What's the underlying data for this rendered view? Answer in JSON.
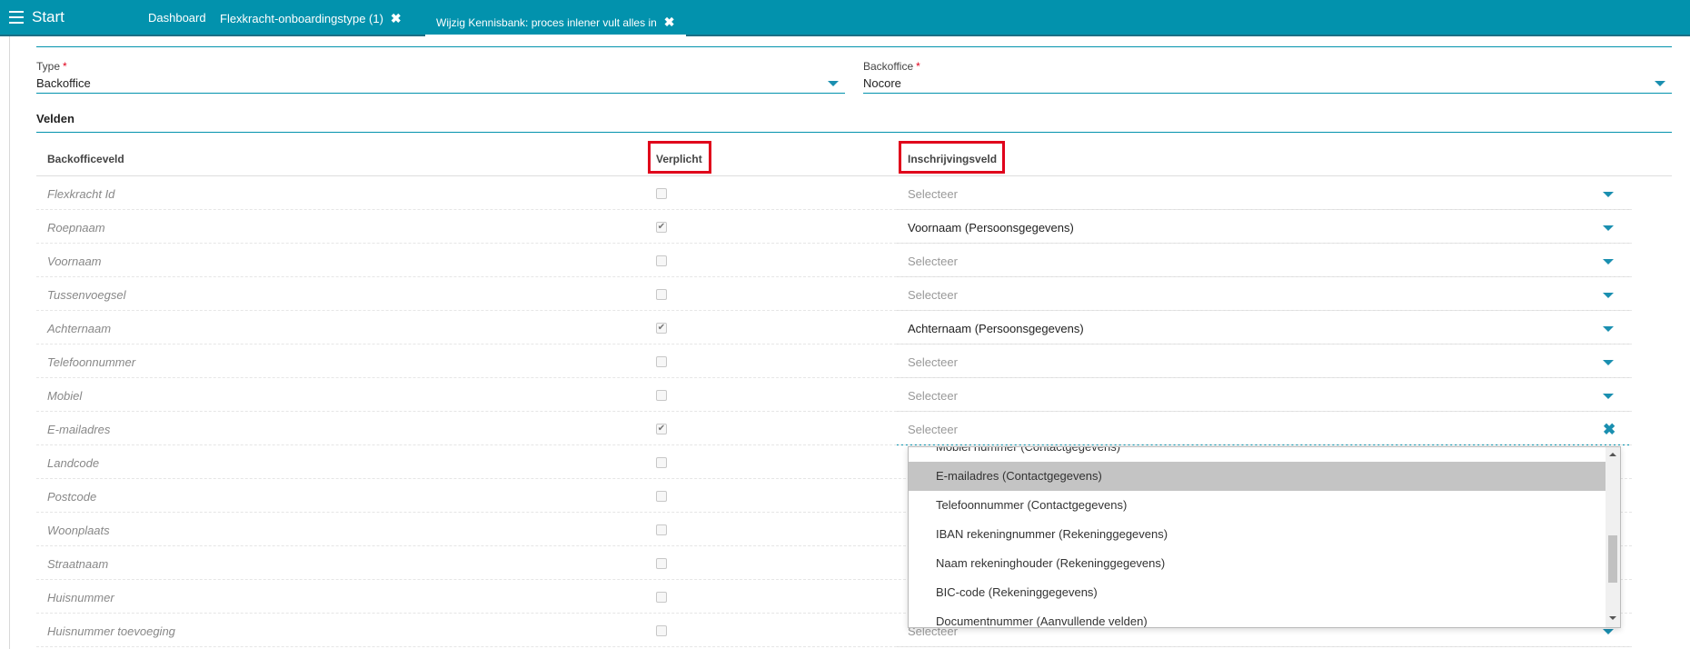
{
  "topbar": {
    "start_label": "Start",
    "tabs": [
      {
        "label": "Dashboard",
        "closable": false
      },
      {
        "label": "Flexkracht-onboardingstype (1)",
        "closable": true
      },
      {
        "label": "Wijzig Kennisbank: proces inlener vult alles in",
        "closable": true,
        "active": true
      }
    ],
    "close_glyph": "✖"
  },
  "form": {
    "type_label": "Type",
    "type_value": "Backoffice",
    "backoffice_label": "Backoffice",
    "backoffice_value": "Nocore",
    "required_mark": "*"
  },
  "velden": {
    "title": "Velden",
    "headers": {
      "backofficeveld": "Backofficeveld",
      "verplicht": "Verplicht",
      "inschrijvingsveld": "Inschrijvingsveld"
    },
    "check_glyph": "✔",
    "rows": [
      {
        "label": "Flexkracht Id",
        "checked": false,
        "value": "Selecteer",
        "filled": false
      },
      {
        "label": "Roepnaam",
        "checked": true,
        "value": "Voornaam (Persoonsgegevens)",
        "filled": true
      },
      {
        "label": "Voornaam",
        "checked": false,
        "value": "Selecteer",
        "filled": false
      },
      {
        "label": "Tussenvoegsel",
        "checked": false,
        "value": "Selecteer",
        "filled": false
      },
      {
        "label": "Achternaam",
        "checked": true,
        "value": "Achternaam (Persoonsgegevens)",
        "filled": true
      },
      {
        "label": "Telefoonnummer",
        "checked": false,
        "value": "Selecteer",
        "filled": false
      },
      {
        "label": "Mobiel",
        "checked": false,
        "value": "Selecteer",
        "filled": false
      },
      {
        "label": "E-mailadres",
        "checked": true,
        "value": "Selecteer",
        "filled": false,
        "open": true
      },
      {
        "label": "Landcode",
        "checked": false
      },
      {
        "label": "Postcode",
        "checked": false
      },
      {
        "label": "Woonplaats",
        "checked": false
      },
      {
        "label": "Straatnaam",
        "checked": false
      },
      {
        "label": "Huisnummer",
        "checked": false
      },
      {
        "label": "Huisnummer toevoeging",
        "checked": false,
        "value": "Selecteer",
        "filled": false
      }
    ]
  },
  "dropdown": {
    "options": [
      "Mobiel nummer (Contactgegevens)",
      "E-mailadres (Contactgegevens)",
      "Telefoonnummer (Contactgegevens)",
      "IBAN rekeningnummer (Rekeninggegevens)",
      "Naam rekeninghouder (Rekeninggegevens)",
      "BIC-code (Rekeninggegevens)",
      "Documentnummer (Aanvullende velden)"
    ],
    "highlighted_index": 1,
    "scroll_position": 0.5
  },
  "colors": {
    "accent": "#0292ad",
    "required": "#e0001b",
    "highlight": "#c4c4c4"
  },
  "icons": {
    "menu": "hamburger-icon",
    "caret": "caret-down-icon",
    "clear": "clear-icon"
  }
}
